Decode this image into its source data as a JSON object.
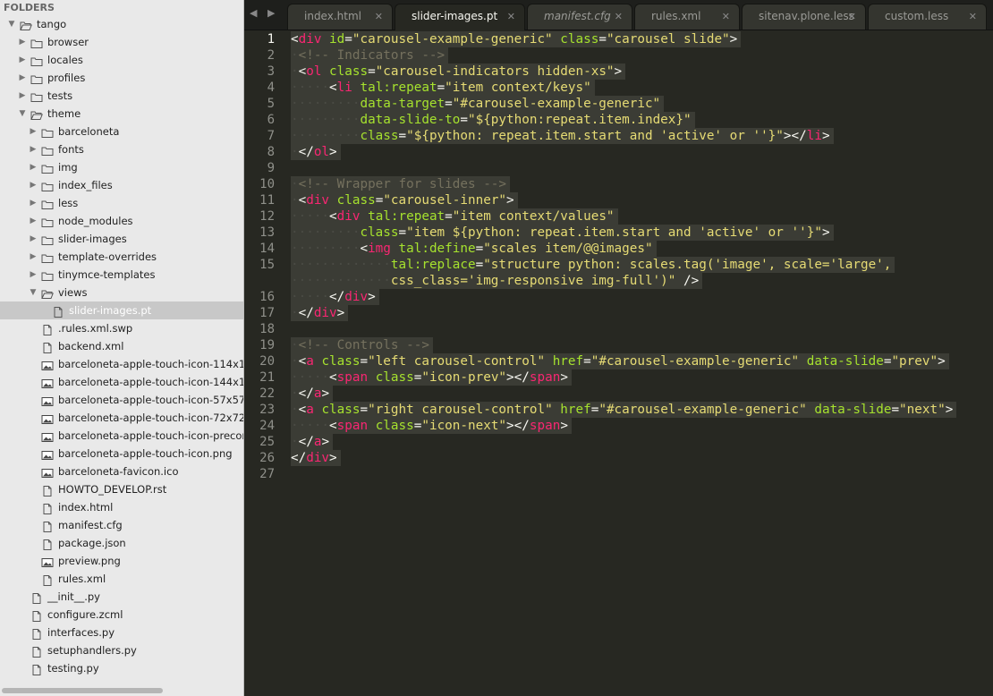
{
  "sidebar": {
    "header": "FOLDERS",
    "tree": [
      {
        "label": "tango",
        "depth": 0,
        "kind": "folder",
        "open": true
      },
      {
        "label": "browser",
        "depth": 1,
        "kind": "folder",
        "open": false
      },
      {
        "label": "locales",
        "depth": 1,
        "kind": "folder",
        "open": false
      },
      {
        "label": "profiles",
        "depth": 1,
        "kind": "folder",
        "open": false
      },
      {
        "label": "tests",
        "depth": 1,
        "kind": "folder",
        "open": false
      },
      {
        "label": "theme",
        "depth": 1,
        "kind": "folder",
        "open": true
      },
      {
        "label": "barceloneta",
        "depth": 2,
        "kind": "folder",
        "open": false
      },
      {
        "label": "fonts",
        "depth": 2,
        "kind": "folder",
        "open": false
      },
      {
        "label": "img",
        "depth": 2,
        "kind": "folder",
        "open": false
      },
      {
        "label": "index_files",
        "depth": 2,
        "kind": "folder",
        "open": false
      },
      {
        "label": "less",
        "depth": 2,
        "kind": "folder",
        "open": false
      },
      {
        "label": "node_modules",
        "depth": 2,
        "kind": "folder",
        "open": false
      },
      {
        "label": "slider-images",
        "depth": 2,
        "kind": "folder",
        "open": false
      },
      {
        "label": "template-overrides",
        "depth": 2,
        "kind": "folder",
        "open": false
      },
      {
        "label": "tinymce-templates",
        "depth": 2,
        "kind": "folder",
        "open": false
      },
      {
        "label": "views",
        "depth": 2,
        "kind": "folder",
        "open": true
      },
      {
        "label": "slider-images.pt",
        "depth": 3,
        "kind": "file",
        "selected": true
      },
      {
        "label": ".rules.xml.swp",
        "depth": 2,
        "kind": "file"
      },
      {
        "label": "backend.xml",
        "depth": 2,
        "kind": "file"
      },
      {
        "label": "barceloneta-apple-touch-icon-114x114",
        "depth": 2,
        "kind": "image"
      },
      {
        "label": "barceloneta-apple-touch-icon-144x144",
        "depth": 2,
        "kind": "image"
      },
      {
        "label": "barceloneta-apple-touch-icon-57x57-p",
        "depth": 2,
        "kind": "image"
      },
      {
        "label": "barceloneta-apple-touch-icon-72x72-pr",
        "depth": 2,
        "kind": "image"
      },
      {
        "label": "barceloneta-apple-touch-icon-precom",
        "depth": 2,
        "kind": "image"
      },
      {
        "label": "barceloneta-apple-touch-icon.png",
        "depth": 2,
        "kind": "image"
      },
      {
        "label": "barceloneta-favicon.ico",
        "depth": 2,
        "kind": "image"
      },
      {
        "label": "HOWTO_DEVELOP.rst",
        "depth": 2,
        "kind": "file"
      },
      {
        "label": "index.html",
        "depth": 2,
        "kind": "file"
      },
      {
        "label": "manifest.cfg",
        "depth": 2,
        "kind": "file"
      },
      {
        "label": "package.json",
        "depth": 2,
        "kind": "file"
      },
      {
        "label": "preview.png",
        "depth": 2,
        "kind": "image"
      },
      {
        "label": "rules.xml",
        "depth": 2,
        "kind": "file"
      },
      {
        "label": "__init__.py",
        "depth": 1,
        "kind": "file"
      },
      {
        "label": "configure.zcml",
        "depth": 1,
        "kind": "file"
      },
      {
        "label": "interfaces.py",
        "depth": 1,
        "kind": "file"
      },
      {
        "label": "setuphandlers.py",
        "depth": 1,
        "kind": "file"
      },
      {
        "label": "testing.py",
        "depth": 1,
        "kind": "file"
      }
    ]
  },
  "tabs": {
    "nav": "◀ ▶",
    "items": [
      {
        "label": "index.html",
        "active": false,
        "italic": false
      },
      {
        "label": "slider-images.pt",
        "active": true,
        "italic": false
      },
      {
        "label": "manifest.cfg",
        "active": false,
        "italic": true
      },
      {
        "label": "rules.xml",
        "active": false,
        "italic": false
      },
      {
        "label": "sitenav.plone.less",
        "active": false,
        "italic": false
      },
      {
        "label": "custom.less",
        "active": false,
        "italic": false
      }
    ],
    "close_glyph": "✕"
  },
  "editor": {
    "current_line": 1,
    "line_numbers": [
      "1",
      "2",
      "3",
      "4",
      "5",
      "6",
      "7",
      "8",
      "9",
      "10",
      "11",
      "12",
      "13",
      "14",
      "15",
      "",
      "16",
      "17",
      "18",
      "19",
      "20",
      "21",
      "22",
      "23",
      "24",
      "25",
      "26",
      "27"
    ],
    "lines": [
      [
        [
          "t-punct",
          "<"
        ],
        [
          "t-tag",
          "div"
        ],
        [
          "t-text",
          " "
        ],
        [
          "t-attr",
          "id"
        ],
        [
          "t-punct",
          "="
        ],
        [
          "t-str",
          "\"carousel-example-generic\""
        ],
        [
          "t-text",
          " "
        ],
        [
          "t-attr",
          "class"
        ],
        [
          "t-punct",
          "="
        ],
        [
          "t-str",
          "\"carousel slide\""
        ],
        [
          "t-punct",
          ">"
        ]
      ],
      [
        [
          "ws",
          "·"
        ],
        [
          "t-comment",
          "<!-- Indicators -->"
        ]
      ],
      [
        [
          "ws",
          "·"
        ],
        [
          "t-punct",
          "<"
        ],
        [
          "t-tag",
          "ol"
        ],
        [
          "t-text",
          " "
        ],
        [
          "t-attr",
          "class"
        ],
        [
          "t-punct",
          "="
        ],
        [
          "t-str",
          "\"carousel-indicators hidden-xs\""
        ],
        [
          "t-punct",
          ">"
        ]
      ],
      [
        [
          "ws",
          "·····"
        ],
        [
          "t-punct",
          "<"
        ],
        [
          "t-tag",
          "li"
        ],
        [
          "t-text",
          " "
        ],
        [
          "t-attr",
          "tal:repeat"
        ],
        [
          "t-punct",
          "="
        ],
        [
          "t-str",
          "\"item context/keys\""
        ]
      ],
      [
        [
          "ws",
          "·········"
        ],
        [
          "t-attr",
          "data-target"
        ],
        [
          "t-punct",
          "="
        ],
        [
          "t-str",
          "\"#carousel-example-generic\""
        ]
      ],
      [
        [
          "ws",
          "·········"
        ],
        [
          "t-attr",
          "data-slide-to"
        ],
        [
          "t-punct",
          "="
        ],
        [
          "t-str",
          "\"${python:repeat.item.index}\""
        ]
      ],
      [
        [
          "ws",
          "·········"
        ],
        [
          "t-attr",
          "class"
        ],
        [
          "t-punct",
          "="
        ],
        [
          "t-str",
          "\"${python: repeat.item.start and 'active' or ''}\""
        ],
        [
          "t-punct",
          "></"
        ],
        [
          "t-tag",
          "li"
        ],
        [
          "t-punct",
          ">"
        ]
      ],
      [
        [
          "ws",
          "·"
        ],
        [
          "t-punct",
          "</"
        ],
        [
          "t-tag",
          "ol"
        ],
        [
          "t-punct",
          ">"
        ]
      ],
      [],
      [
        [
          "ws",
          "·"
        ],
        [
          "t-comment",
          "<!-- Wrapper for slides -->"
        ]
      ],
      [
        [
          "ws",
          "·"
        ],
        [
          "t-punct",
          "<"
        ],
        [
          "t-tag",
          "div"
        ],
        [
          "t-text",
          " "
        ],
        [
          "t-attr",
          "class"
        ],
        [
          "t-punct",
          "="
        ],
        [
          "t-str",
          "\"carousel-inner\""
        ],
        [
          "t-punct",
          ">"
        ]
      ],
      [
        [
          "ws",
          "·····"
        ],
        [
          "t-punct",
          "<"
        ],
        [
          "t-tag",
          "div"
        ],
        [
          "t-text",
          " "
        ],
        [
          "t-attr",
          "tal:repeat"
        ],
        [
          "t-punct",
          "="
        ],
        [
          "t-str",
          "\"item context/values\""
        ]
      ],
      [
        [
          "ws",
          "·········"
        ],
        [
          "t-attr",
          "class"
        ],
        [
          "t-punct",
          "="
        ],
        [
          "t-str",
          "\"item ${python: repeat.item.start and 'active' or ''}\""
        ],
        [
          "t-punct",
          ">"
        ]
      ],
      [
        [
          "ws",
          "·········"
        ],
        [
          "t-punct",
          "<"
        ],
        [
          "t-tag",
          "img"
        ],
        [
          "t-text",
          " "
        ],
        [
          "t-attr",
          "tal:define"
        ],
        [
          "t-punct",
          "="
        ],
        [
          "t-str",
          "\"scales item/@@images\""
        ]
      ],
      [
        [
          "ws",
          "·············"
        ],
        [
          "t-attr",
          "tal:replace"
        ],
        [
          "t-punct",
          "="
        ],
        [
          "t-str",
          "\"structure python: scales.tag('image', scale='large',"
        ]
      ],
      [
        [
          "ws",
          "·············"
        ],
        [
          "t-str",
          "css_class='img-responsive img-full')\""
        ],
        [
          "t-text",
          " "
        ],
        [
          "t-punct",
          "/>"
        ]
      ],
      [
        [
          "ws",
          "·····"
        ],
        [
          "t-punct",
          "</"
        ],
        [
          "t-tag",
          "div"
        ],
        [
          "t-punct",
          ">"
        ]
      ],
      [
        [
          "ws",
          "·"
        ],
        [
          "t-punct",
          "</"
        ],
        [
          "t-tag",
          "div"
        ],
        [
          "t-punct",
          ">"
        ]
      ],
      [],
      [
        [
          "ws",
          "·"
        ],
        [
          "t-comment",
          "<!-- Controls -->"
        ]
      ],
      [
        [
          "ws",
          "·"
        ],
        [
          "t-punct",
          "<"
        ],
        [
          "t-tag",
          "a"
        ],
        [
          "t-text",
          " "
        ],
        [
          "t-attr",
          "class"
        ],
        [
          "t-punct",
          "="
        ],
        [
          "t-str",
          "\"left carousel-control\""
        ],
        [
          "t-text",
          " "
        ],
        [
          "t-attr",
          "href"
        ],
        [
          "t-punct",
          "="
        ],
        [
          "t-str",
          "\"#carousel-example-generic\""
        ],
        [
          "t-text",
          " "
        ],
        [
          "t-attr",
          "data-slide"
        ],
        [
          "t-punct",
          "="
        ],
        [
          "t-str",
          "\"prev\""
        ],
        [
          "t-punct",
          ">"
        ]
      ],
      [
        [
          "ws",
          "·····"
        ],
        [
          "t-punct",
          "<"
        ],
        [
          "t-tag",
          "span"
        ],
        [
          "t-text",
          " "
        ],
        [
          "t-attr",
          "class"
        ],
        [
          "t-punct",
          "="
        ],
        [
          "t-str",
          "\"icon-prev\""
        ],
        [
          "t-punct",
          "></"
        ],
        [
          "t-tag",
          "span"
        ],
        [
          "t-punct",
          ">"
        ]
      ],
      [
        [
          "ws",
          "·"
        ],
        [
          "t-punct",
          "</"
        ],
        [
          "t-tag",
          "a"
        ],
        [
          "t-punct",
          ">"
        ]
      ],
      [
        [
          "ws",
          "·"
        ],
        [
          "t-punct",
          "<"
        ],
        [
          "t-tag",
          "a"
        ],
        [
          "t-text",
          " "
        ],
        [
          "t-attr",
          "class"
        ],
        [
          "t-punct",
          "="
        ],
        [
          "t-str",
          "\"right carousel-control\""
        ],
        [
          "t-text",
          " "
        ],
        [
          "t-attr",
          "href"
        ],
        [
          "t-punct",
          "="
        ],
        [
          "t-str",
          "\"#carousel-example-generic\""
        ],
        [
          "t-text",
          " "
        ],
        [
          "t-attr",
          "data-slide"
        ],
        [
          "t-punct",
          "="
        ],
        [
          "t-str",
          "\"next\""
        ],
        [
          "t-punct",
          ">"
        ]
      ],
      [
        [
          "ws",
          "·····"
        ],
        [
          "t-punct",
          "<"
        ],
        [
          "t-tag",
          "span"
        ],
        [
          "t-text",
          " "
        ],
        [
          "t-attr",
          "class"
        ],
        [
          "t-punct",
          "="
        ],
        [
          "t-str",
          "\"icon-next\""
        ],
        [
          "t-punct",
          "></"
        ],
        [
          "t-tag",
          "span"
        ],
        [
          "t-punct",
          ">"
        ]
      ],
      [
        [
          "ws",
          "·"
        ],
        [
          "t-punct",
          "</"
        ],
        [
          "t-tag",
          "a"
        ],
        [
          "t-punct",
          ">"
        ]
      ],
      [
        [
          "t-punct",
          "</"
        ],
        [
          "t-tag",
          "div"
        ],
        [
          "t-punct",
          ">"
        ]
      ],
      []
    ]
  }
}
